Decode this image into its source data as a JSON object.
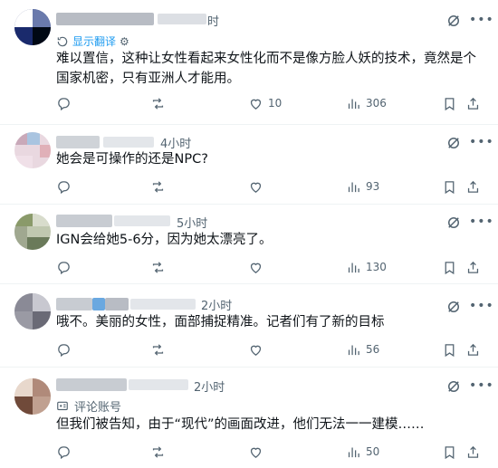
{
  "replies": [
    {
      "time": "时",
      "translate_label": "显示翻译",
      "text": "难以置信，这种让女性看起来女性化而不是像方脸人妖的技术，竟然是个国家机密，只有亚洲人才能用。",
      "likes": "10",
      "views": "306",
      "colors": {
        "a1": "#1a2a6c",
        "a2": "#000814",
        "a3": "#3a4a8c",
        "name": "#b8bcc4"
      }
    },
    {
      "time": "4小时",
      "text": "她会是可操作的还是NPC?",
      "views": "93",
      "colors": {
        "a1": "#c9a9b9",
        "a2": "#e9d8e0",
        "a3": "#a9c4e0",
        "name": "#cfd3d8"
      }
    },
    {
      "time": "5小时",
      "text": "IGN会给她5-6分，因为她太漂亮了。",
      "views": "130",
      "colors": {
        "a1": "#8a9a6a",
        "a2": "#c0c8b0",
        "a3": "#6a7a5a",
        "name": "#c8ccd2"
      }
    },
    {
      "time": "2小时",
      "text": "哦不。美丽的女性，面部捕捉精准。记者们有了新的目标",
      "views": "56",
      "colors": {
        "a1": "#8a8a96",
        "a2": "#b0b0ba",
        "a3": "#6a6a76",
        "name": "#c8ccd2",
        "badge": "#6aa8e0"
      }
    },
    {
      "time": "2小时",
      "community_label": "评论账号",
      "text": "但我们被告知，由于“现代”的画面改进，他们无法一一建模……",
      "views": "50",
      "colors": {
        "a1": "#b08a7a",
        "a2": "#d8c0b0",
        "a3": "#704a3a",
        "name": "#c8ccd2"
      }
    }
  ],
  "icons": {
    "reply": "reply-icon",
    "repost": "repost-icon",
    "like": "heart-icon",
    "views": "views-icon",
    "bookmark": "bookmark-icon",
    "share": "share-icon",
    "grok": "grok-icon",
    "more": "more-icon",
    "translate": "translate-icon",
    "community": "community-notes-icon"
  },
  "theme": {
    "accent": "#1d9bf0",
    "muted": "#536471",
    "text": "#0f1419",
    "border": "#eff3f4"
  }
}
